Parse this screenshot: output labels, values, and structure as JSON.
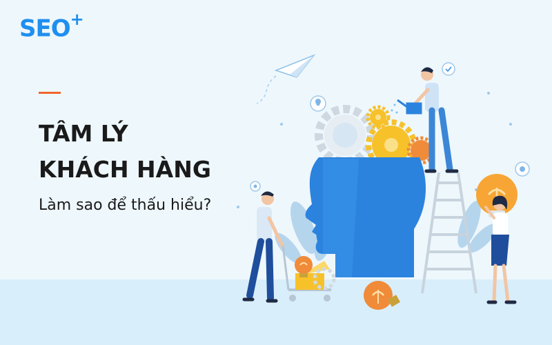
{
  "brand": {
    "name": "SEO",
    "superscript": "+"
  },
  "headline": {
    "line1": "TÂM LÝ",
    "line2": "KHÁCH HÀNG"
  },
  "subheadline": "Làm sao để thấu hiểu?",
  "colors": {
    "background": "#eef7fc",
    "brand_blue": "#1f8ff0",
    "accent_orange": "#f0652c",
    "head_blue": "#2b83de",
    "gear_yellow": "#f7c12a"
  }
}
